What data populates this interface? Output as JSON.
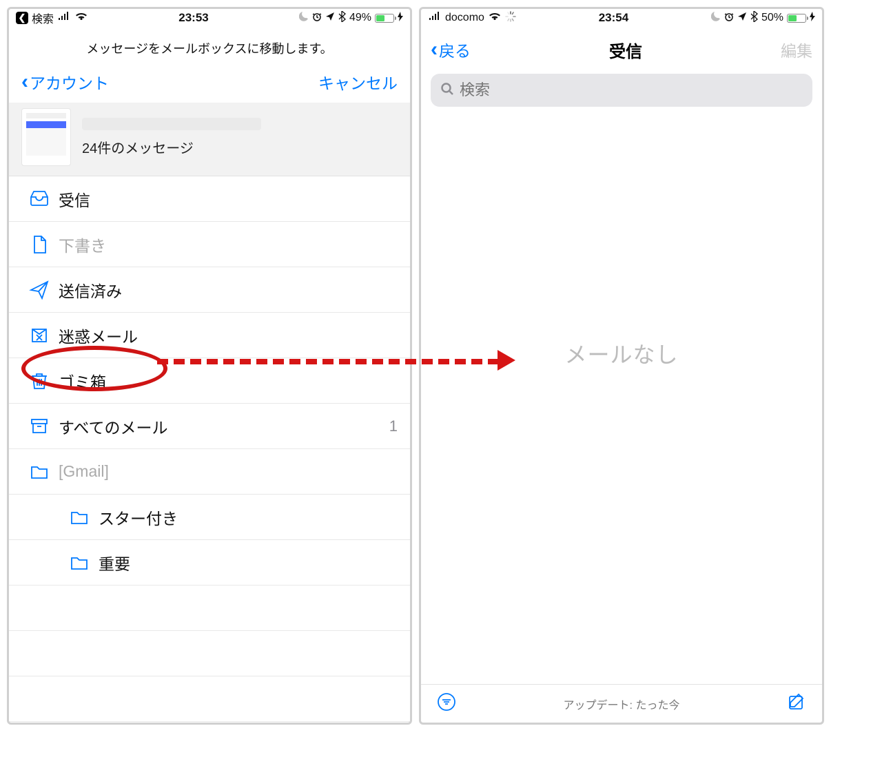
{
  "left": {
    "status": {
      "back": "❮",
      "carrier": "検索",
      "time": "23:53",
      "battery": "49%"
    },
    "move_prompt": "メッセージをメールボックスに移動します。",
    "nav": {
      "back": "アカウント",
      "cancel": "キャンセル"
    },
    "summary": {
      "count": "24件のメッセージ"
    },
    "rows": [
      {
        "icon": "inbox",
        "label": "受信",
        "dim": false,
        "sub": false
      },
      {
        "icon": "draft",
        "label": "下書き",
        "dim": true,
        "sub": false
      },
      {
        "icon": "send",
        "label": "送信済み",
        "dim": false,
        "sub": false
      },
      {
        "icon": "junk",
        "label": "迷惑メール",
        "dim": false,
        "sub": false
      },
      {
        "icon": "trash",
        "label": "ゴミ箱",
        "dim": false,
        "sub": false
      },
      {
        "icon": "archive",
        "label": "すべてのメール",
        "dim": false,
        "sub": false,
        "count": "1"
      },
      {
        "icon": "folder",
        "label": "[Gmail]",
        "dim": true,
        "sub": false
      },
      {
        "icon": "folder",
        "label": "スター付き",
        "dim": false,
        "sub": true
      },
      {
        "icon": "folder",
        "label": "重要",
        "dim": false,
        "sub": true
      }
    ]
  },
  "right": {
    "status": {
      "carrier": "docomo",
      "time": "23:54",
      "battery": "50%"
    },
    "nav": {
      "back": "戻る",
      "title": "受信",
      "edit": "編集"
    },
    "search_placeholder": "検索",
    "empty": "メールなし",
    "toolbar": {
      "status": "アップデート: たった今"
    }
  }
}
